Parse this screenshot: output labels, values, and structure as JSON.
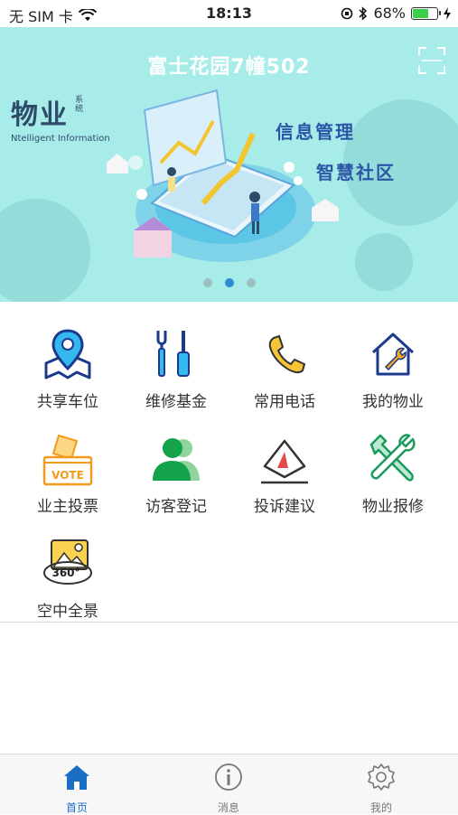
{
  "status_bar": {
    "carrier": "无 SIM 卡",
    "time": "18:13",
    "battery": "68%",
    "battery_level": 0.68
  },
  "banner": {
    "title": "富士花园7幢502",
    "brand_main": "物业",
    "brand_small": "系统",
    "brand_sub": "Ntelligent Information",
    "slogan_1": "信息管理",
    "slogan_2": "智慧社区",
    "page_count": 3,
    "active_page": 2
  },
  "menu": [
    {
      "label": "共享车位",
      "icon": "location-map-icon"
    },
    {
      "label": "维修基金",
      "icon": "wrench-screwdriver-icon"
    },
    {
      "label": "常用电话",
      "icon": "phone-icon"
    },
    {
      "label": "我的物业",
      "icon": "house-wrench-icon"
    },
    {
      "label": "业主投票",
      "icon": "vote-box-icon"
    },
    {
      "label": "访客登记",
      "icon": "visitor-icon"
    },
    {
      "label": "投诉建议",
      "icon": "complaint-icon"
    },
    {
      "label": "物业报修",
      "icon": "repair-tools-icon"
    },
    {
      "label": "空中全景",
      "icon": "panorama-360-icon"
    }
  ],
  "tabs": [
    {
      "label": "首页",
      "icon": "home-icon",
      "active": true
    },
    {
      "label": "消息",
      "icon": "info-icon",
      "active": false
    },
    {
      "label": "我的",
      "icon": "gear-icon",
      "active": false
    }
  ],
  "colors": {
    "accent": "#1a6fc4",
    "banner_bg": "#a8ece9",
    "slogan": "#2b56a8"
  }
}
